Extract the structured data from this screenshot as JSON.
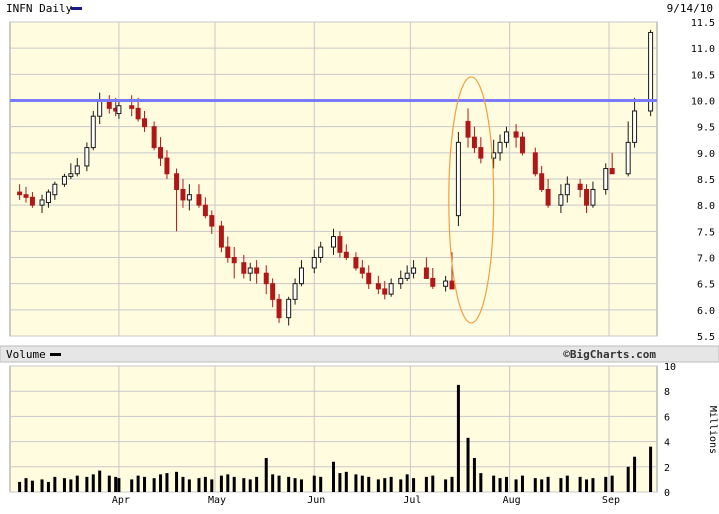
{
  "price_panel": {
    "title": "INFN Daily",
    "date": "9/14/10",
    "legend_swatch_color": "#1a1a8c"
  },
  "volume_panel": {
    "title": "Volume",
    "brand": "©BigCharts.com",
    "unit_label": "Millions"
  },
  "colors": {
    "panel_bg": "#fffce0",
    "grid": "#c8c8c8",
    "up": "#1a1a1a",
    "down": "#b01818",
    "resistance_line": "#7a7aff",
    "annotation_ellipse": "#f0a040",
    "volume_bar": "#000000"
  },
  "annotations": {
    "resistance_level": 10.0,
    "highlight_dates": [
      "2010-07-13",
      "2010-07-27"
    ],
    "highlight_price_range": [
      5.75,
      10.45
    ]
  },
  "chart_data": [
    {
      "type": "candlestick",
      "title": "INFN Daily",
      "x_tick_labels": [
        "Apr",
        "May",
        "Jun",
        "Jul",
        "Aug",
        "Sep"
      ],
      "y_tick_labels": [
        "11.5",
        "11.0",
        "10.5",
        "10.0",
        "9.5",
        "9.0",
        "8.5",
        "8.0",
        "7.5",
        "7.0",
        "6.5",
        "6.0",
        "5.5"
      ],
      "ylim": [
        5.5,
        11.5
      ],
      "grid": true,
      "y_axis_side": "right",
      "series": [
        {
          "dates": [
            "2010-03-01",
            "2010-03-03",
            "2010-03-05",
            "2010-03-08",
            "2010-03-10",
            "2010-03-12",
            "2010-03-15",
            "2010-03-17",
            "2010-03-19",
            "2010-03-22",
            "2010-03-24",
            "2010-03-26",
            "2010-03-29",
            "2010-03-31",
            "2010-04-01",
            "2010-04-05",
            "2010-04-07",
            "2010-04-09",
            "2010-04-12",
            "2010-04-14",
            "2010-04-16",
            "2010-04-19",
            "2010-04-21",
            "2010-04-23",
            "2010-04-26",
            "2010-04-28",
            "2010-04-30",
            "2010-05-03",
            "2010-05-05",
            "2010-05-07",
            "2010-05-10",
            "2010-05-12",
            "2010-05-14",
            "2010-05-17",
            "2010-05-19",
            "2010-05-21",
            "2010-05-24",
            "2010-05-26",
            "2010-05-28",
            "2010-06-01",
            "2010-06-03",
            "2010-06-07",
            "2010-06-09",
            "2010-06-11",
            "2010-06-14",
            "2010-06-16",
            "2010-06-18",
            "2010-06-21",
            "2010-06-23",
            "2010-06-25",
            "2010-06-28",
            "2010-06-30",
            "2010-07-02",
            "2010-07-06",
            "2010-07-08",
            "2010-07-12",
            "2010-07-14",
            "2010-07-16",
            "2010-07-19",
            "2010-07-21",
            "2010-07-23",
            "2010-07-27",
            "2010-07-29",
            "2010-07-31",
            "2010-08-03",
            "2010-08-05",
            "2010-08-09",
            "2010-08-11",
            "2010-08-13",
            "2010-08-17",
            "2010-08-19",
            "2010-08-23",
            "2010-08-25",
            "2010-08-27",
            "2010-08-31",
            "2010-09-02",
            "2010-09-07",
            "2010-09-09",
            "2010-09-14"
          ],
          "open": [
            8.25,
            8.2,
            8.15,
            8.0,
            8.05,
            8.2,
            8.4,
            8.55,
            8.6,
            8.75,
            9.1,
            9.7,
            10.0,
            9.85,
            9.75,
            9.9,
            9.85,
            9.65,
            9.5,
            9.1,
            8.9,
            8.6,
            8.3,
            8.1,
            8.2,
            8.0,
            7.8,
            7.6,
            7.2,
            7.0,
            6.9,
            6.7,
            6.8,
            6.7,
            6.5,
            6.2,
            5.85,
            6.2,
            6.5,
            6.8,
            7.0,
            7.2,
            7.4,
            7.1,
            7.0,
            6.8,
            6.7,
            6.5,
            6.4,
            6.3,
            6.5,
            6.6,
            6.7,
            6.8,
            6.6,
            6.45,
            6.55,
            7.8,
            9.6,
            9.3,
            9.1,
            8.9,
            9.0,
            9.2,
            9.4,
            9.3,
            9.0,
            8.6,
            8.3,
            8.0,
            8.2,
            8.4,
            8.3,
            8.0,
            8.3,
            8.7,
            8.6,
            9.2,
            9.8
          ],
          "high": [
            8.4,
            8.35,
            8.25,
            8.2,
            8.3,
            8.45,
            8.6,
            8.8,
            8.9,
            9.2,
            9.8,
            10.15,
            10.1,
            10.05,
            10.0,
            10.1,
            10.05,
            9.8,
            9.6,
            9.3,
            9.05,
            8.7,
            8.5,
            8.4,
            8.4,
            8.15,
            7.9,
            7.7,
            7.4,
            7.2,
            7.05,
            6.9,
            6.95,
            6.85,
            6.6,
            6.3,
            6.25,
            6.6,
            6.95,
            7.15,
            7.3,
            7.55,
            7.5,
            7.25,
            7.1,
            6.95,
            6.85,
            6.65,
            6.55,
            6.6,
            6.75,
            6.85,
            6.95,
            7.0,
            6.8,
            6.65,
            7.1,
            9.4,
            9.85,
            9.5,
            9.3,
            9.25,
            9.35,
            9.5,
            9.55,
            9.4,
            9.1,
            8.75,
            8.5,
            8.4,
            8.55,
            8.5,
            8.4,
            8.45,
            8.8,
            9.0,
            9.6,
            10.05,
            11.35
          ],
          "low": [
            8.1,
            8.05,
            7.95,
            7.85,
            7.95,
            8.1,
            8.35,
            8.5,
            8.55,
            8.65,
            9.05,
            9.55,
            9.75,
            9.7,
            9.65,
            9.7,
            9.6,
            9.4,
            9.05,
            8.75,
            8.5,
            7.5,
            7.95,
            7.9,
            7.95,
            7.75,
            7.45,
            7.1,
            6.9,
            6.6,
            6.6,
            6.55,
            6.5,
            6.3,
            6.05,
            5.75,
            5.7,
            6.1,
            6.45,
            6.7,
            6.9,
            7.05,
            7.0,
            6.95,
            6.75,
            6.6,
            6.4,
            6.3,
            6.2,
            6.25,
            6.4,
            6.55,
            6.6,
            6.6,
            6.4,
            6.35,
            6.4,
            7.6,
            9.1,
            9.0,
            8.8,
            8.7,
            8.85,
            9.1,
            9.1,
            8.95,
            8.55,
            8.25,
            7.95,
            7.85,
            8.05,
            8.15,
            7.85,
            7.95,
            8.2,
            8.6,
            8.55,
            9.1,
            9.7
          ],
          "close": [
            8.2,
            8.15,
            8.0,
            8.1,
            8.25,
            8.4,
            8.55,
            8.6,
            8.75,
            9.1,
            9.7,
            10.0,
            9.85,
            9.8,
            9.9,
            9.85,
            9.65,
            9.5,
            9.1,
            8.9,
            8.6,
            8.3,
            8.1,
            8.2,
            8.0,
            7.8,
            7.6,
            7.2,
            7.0,
            6.9,
            6.7,
            6.8,
            6.7,
            6.5,
            6.2,
            5.85,
            6.2,
            6.5,
            6.8,
            7.0,
            7.2,
            7.4,
            7.1,
            7.0,
            6.8,
            6.7,
            6.5,
            6.4,
            6.3,
            6.5,
            6.6,
            6.7,
            6.8,
            6.6,
            6.45,
            6.55,
            6.4,
            9.2,
            9.3,
            9.1,
            8.9,
            9.0,
            9.2,
            9.4,
            9.3,
            9.0,
            8.6,
            8.3,
            8.0,
            8.2,
            8.4,
            8.3,
            8.0,
            8.3,
            8.7,
            8.6,
            9.2,
            9.8,
            11.3
          ]
        }
      ]
    },
    {
      "type": "bar",
      "title": "Volume",
      "ylabel": "Millions",
      "y_tick_labels": [
        "10",
        "8",
        "6",
        "4",
        "2",
        "0"
      ],
      "ylim": [
        0,
        10
      ],
      "grid": true,
      "y_axis_side": "right",
      "x_tick_labels": [
        "Apr",
        "May",
        "Jun",
        "Jul",
        "Aug",
        "Sep"
      ],
      "series": [
        {
          "dates": [
            "2010-03-01",
            "2010-03-03",
            "2010-03-05",
            "2010-03-08",
            "2010-03-10",
            "2010-03-12",
            "2010-03-15",
            "2010-03-17",
            "2010-03-19",
            "2010-03-22",
            "2010-03-24",
            "2010-03-26",
            "2010-03-29",
            "2010-03-31",
            "2010-04-01",
            "2010-04-05",
            "2010-04-07",
            "2010-04-09",
            "2010-04-12",
            "2010-04-14",
            "2010-04-16",
            "2010-04-19",
            "2010-04-21",
            "2010-04-23",
            "2010-04-26",
            "2010-04-28",
            "2010-04-30",
            "2010-05-03",
            "2010-05-05",
            "2010-05-07",
            "2010-05-10",
            "2010-05-12",
            "2010-05-14",
            "2010-05-17",
            "2010-05-19",
            "2010-05-21",
            "2010-05-24",
            "2010-05-26",
            "2010-05-28",
            "2010-06-01",
            "2010-06-03",
            "2010-06-07",
            "2010-06-09",
            "2010-06-11",
            "2010-06-14",
            "2010-06-16",
            "2010-06-18",
            "2010-06-21",
            "2010-06-23",
            "2010-06-25",
            "2010-06-28",
            "2010-06-30",
            "2010-07-02",
            "2010-07-06",
            "2010-07-08",
            "2010-07-12",
            "2010-07-14",
            "2010-07-16",
            "2010-07-19",
            "2010-07-21",
            "2010-07-23",
            "2010-07-27",
            "2010-07-29",
            "2010-07-31",
            "2010-08-03",
            "2010-08-05",
            "2010-08-09",
            "2010-08-11",
            "2010-08-13",
            "2010-08-17",
            "2010-08-19",
            "2010-08-23",
            "2010-08-25",
            "2010-08-27",
            "2010-08-31",
            "2010-09-02",
            "2010-09-07",
            "2010-09-09",
            "2010-09-14"
          ],
          "values": [
            0.8,
            1.1,
            0.9,
            1.0,
            0.8,
            1.2,
            1.1,
            1.0,
            1.3,
            1.2,
            1.4,
            1.7,
            1.3,
            1.2,
            1.1,
            1.0,
            1.3,
            1.2,
            1.1,
            1.4,
            1.5,
            1.6,
            1.2,
            1.0,
            1.1,
            1.2,
            1.0,
            1.3,
            1.4,
            1.2,
            1.1,
            1.0,
            1.2,
            2.7,
            1.4,
            1.3,
            1.2,
            1.1,
            1.0,
            1.3,
            1.2,
            2.4,
            1.5,
            1.6,
            1.4,
            1.3,
            1.2,
            1.0,
            1.1,
            1.2,
            1.0,
            1.4,
            1.1,
            1.2,
            1.3,
            1.0,
            1.2,
            8.5,
            4.3,
            2.7,
            1.5,
            1.3,
            1.1,
            1.2,
            1.0,
            1.3,
            1.1,
            1.0,
            1.2,
            1.1,
            1.3,
            1.2,
            1.0,
            1.1,
            1.2,
            1.3,
            2.0,
            2.8,
            3.6
          ]
        }
      ]
    }
  ]
}
